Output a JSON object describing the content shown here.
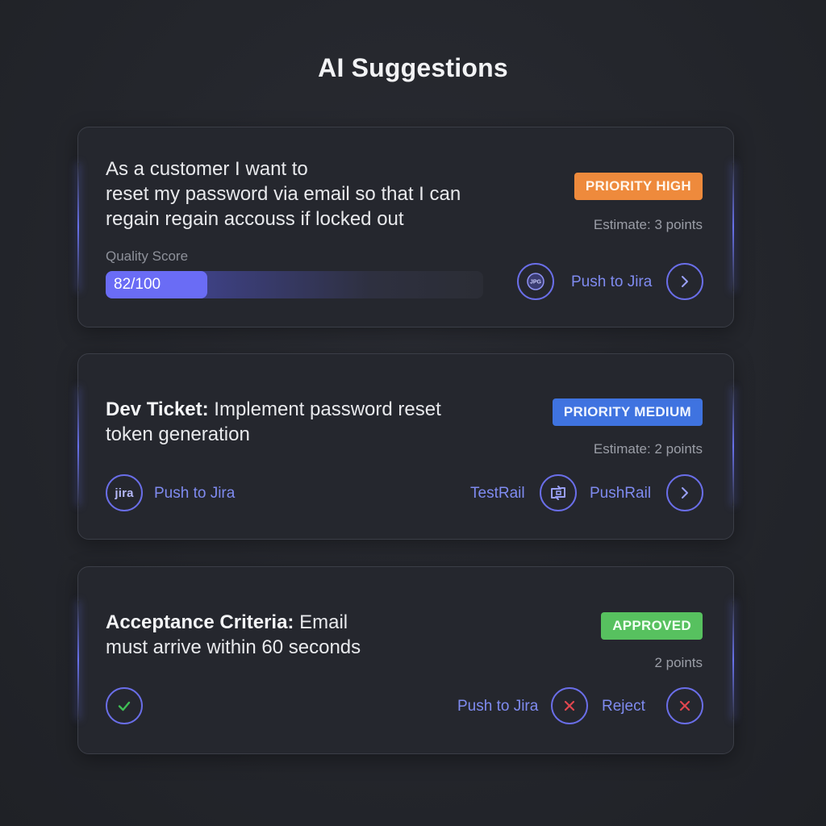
{
  "page": {
    "title": "AI Suggestions"
  },
  "cards": [
    {
      "text": "As a customer I want to\nreset my password via email so that I can\nregain regain accouss if locked out",
      "badge": "PRIORITY HIGH",
      "estimate": "Estimate: 3 points",
      "quality_label": "Quality Score",
      "quality_value": "82/100",
      "quality_fraction": 0.27,
      "actions": {
        "push_label": "Push to Jira"
      }
    },
    {
      "text_bold": "Dev Ticket:",
      "text_rest": " Implement password reset\ntoken generation",
      "badge": "PRIORITY MEDIUM",
      "estimate": "Estimate: 2 points",
      "actions": {
        "jira_icon_text": "jira",
        "push_label": "Push to Jira",
        "testrail_label": "TestRail",
        "pushrail_label": "PushRail"
      }
    },
    {
      "text_bold": "Acceptance Criteria:",
      "text_rest": " Email\nmust arrive within 60 seconds",
      "badge": "APPROVED",
      "estimate": "2 points",
      "actions": {
        "push_label": "Push to Jira",
        "reject_label": "Reject"
      }
    }
  ],
  "colors": {
    "accent": "#6a6ee8",
    "high": "#ee8a3c",
    "medium": "#3f73e0",
    "approved": "#57c15f",
    "reject": "#e0474f",
    "check": "#3fbf55"
  },
  "icons": {
    "jira": "jira-logo-icon",
    "chevron": "chevron-right-icon",
    "testrail": "testrail-icon",
    "check": "check-icon",
    "reject": "close-icon"
  }
}
